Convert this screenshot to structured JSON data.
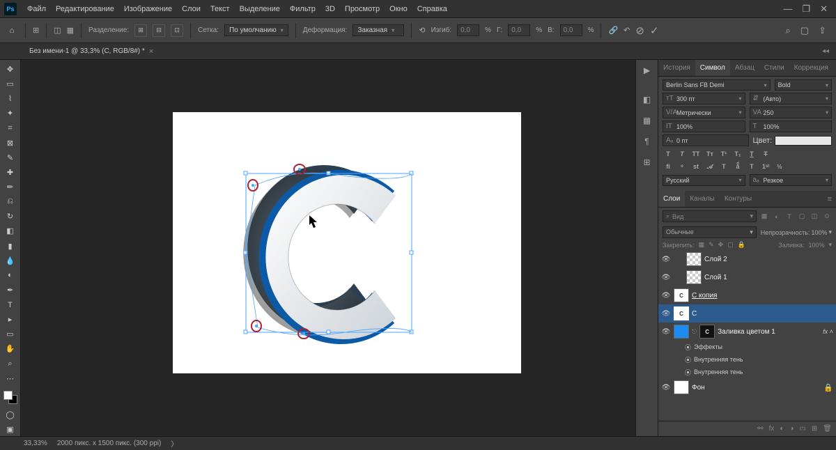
{
  "menubar": {
    "items": [
      "Файл",
      "Редактирование",
      "Изображение",
      "Слои",
      "Текст",
      "Выделение",
      "Фильтр",
      "3D",
      "Просмотр",
      "Окно",
      "Справка"
    ]
  },
  "optionsbar": {
    "split_label": "Разделение:",
    "grid_label": "Сетка:",
    "grid_value": "По умолчанию",
    "deform_label": "Деформация:",
    "deform_value": "Заказная",
    "bend_label": "Изгиб:",
    "bend_value": "0,0",
    "h_label": "Г:",
    "h_value": "0,0",
    "v_label": "В:",
    "v_value": "0,0"
  },
  "document": {
    "tab_title": "Без имени-1 @ 33,3% (C, RGB/8#) *"
  },
  "panels": {
    "top_tabs": [
      "История",
      "Символ",
      "Абзац",
      "Стили",
      "Коррекция"
    ],
    "active_top": 1,
    "character": {
      "font": "Berlin Sans FB Demi",
      "style": "Bold",
      "size": "300 пт",
      "leading": "(Авто)",
      "kerning": "Метрически",
      "tracking": "250",
      "vscale": "100%",
      "hscale": "100%",
      "baseline": "0 пт",
      "color_label": "Цвет:",
      "lang": "Русский",
      "aa": "Резкое"
    },
    "layers_tabs": [
      "Слои",
      "Каналы",
      "Контуры"
    ],
    "active_layers": 0,
    "layers": {
      "search_placeholder": "Вид",
      "blend": "Обычные",
      "opacity_label": "Непрозрачность:",
      "opacity": "100%",
      "lock_label": "Закрепить:",
      "fill_label": "Заливка:",
      "fill": "100%",
      "items": [
        {
          "name": "Слой 2",
          "thumb": "checker"
        },
        {
          "name": "Слой 1",
          "thumb": "checker"
        },
        {
          "name": "С копия",
          "thumb": "c",
          "link": true,
          "underline": true
        },
        {
          "name": "С",
          "thumb": "c",
          "selected": true,
          "link": true
        },
        {
          "name": "Заливка цветом 1",
          "thumb": "blue",
          "mask": true,
          "fx": true
        },
        {
          "name": "Фон",
          "thumb": "white",
          "locked": true
        }
      ],
      "effects_label": "Эффекты",
      "effect_items": [
        "Внутренняя тень",
        "Внутренняя тень"
      ]
    }
  },
  "statusbar": {
    "zoom": "33,33%",
    "info": "2000 пикс. x 1500 пикс. (300 ppi)"
  }
}
